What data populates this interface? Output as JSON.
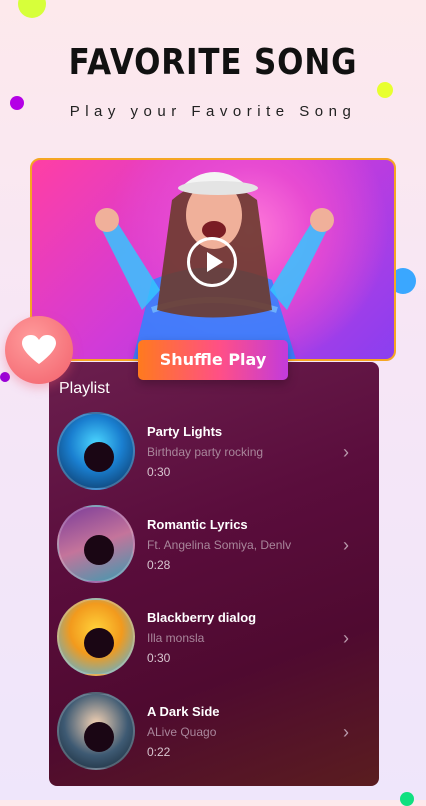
{
  "header": {
    "title": "FAVORITE SONG",
    "subtitle": "Play your Favorite Song"
  },
  "hero": {
    "play_icon": "play-icon"
  },
  "shuffle_button": "Shuffle Play",
  "heart_icon": "heart-icon",
  "playlist": {
    "title": "Playlist",
    "songs": [
      {
        "title": "Party Lights",
        "artist": "Birthday party rocking",
        "duration": "0:30"
      },
      {
        "title": "Romantic Lyrics",
        "artist": "Ft. Angelina Somiya, Denlv",
        "duration": "0:28"
      },
      {
        "title": "Blackberry dialog",
        "artist": "Illa monsla",
        "duration": "0:30"
      },
      {
        "title": "A Dark Side",
        "artist": "ALive Quago",
        "duration": "0:22"
      }
    ]
  },
  "colors": {
    "accent_gradient_start": "#ff7a1e",
    "accent_gradient_end": "#c23bdc",
    "panel": "#5a0d3c"
  }
}
